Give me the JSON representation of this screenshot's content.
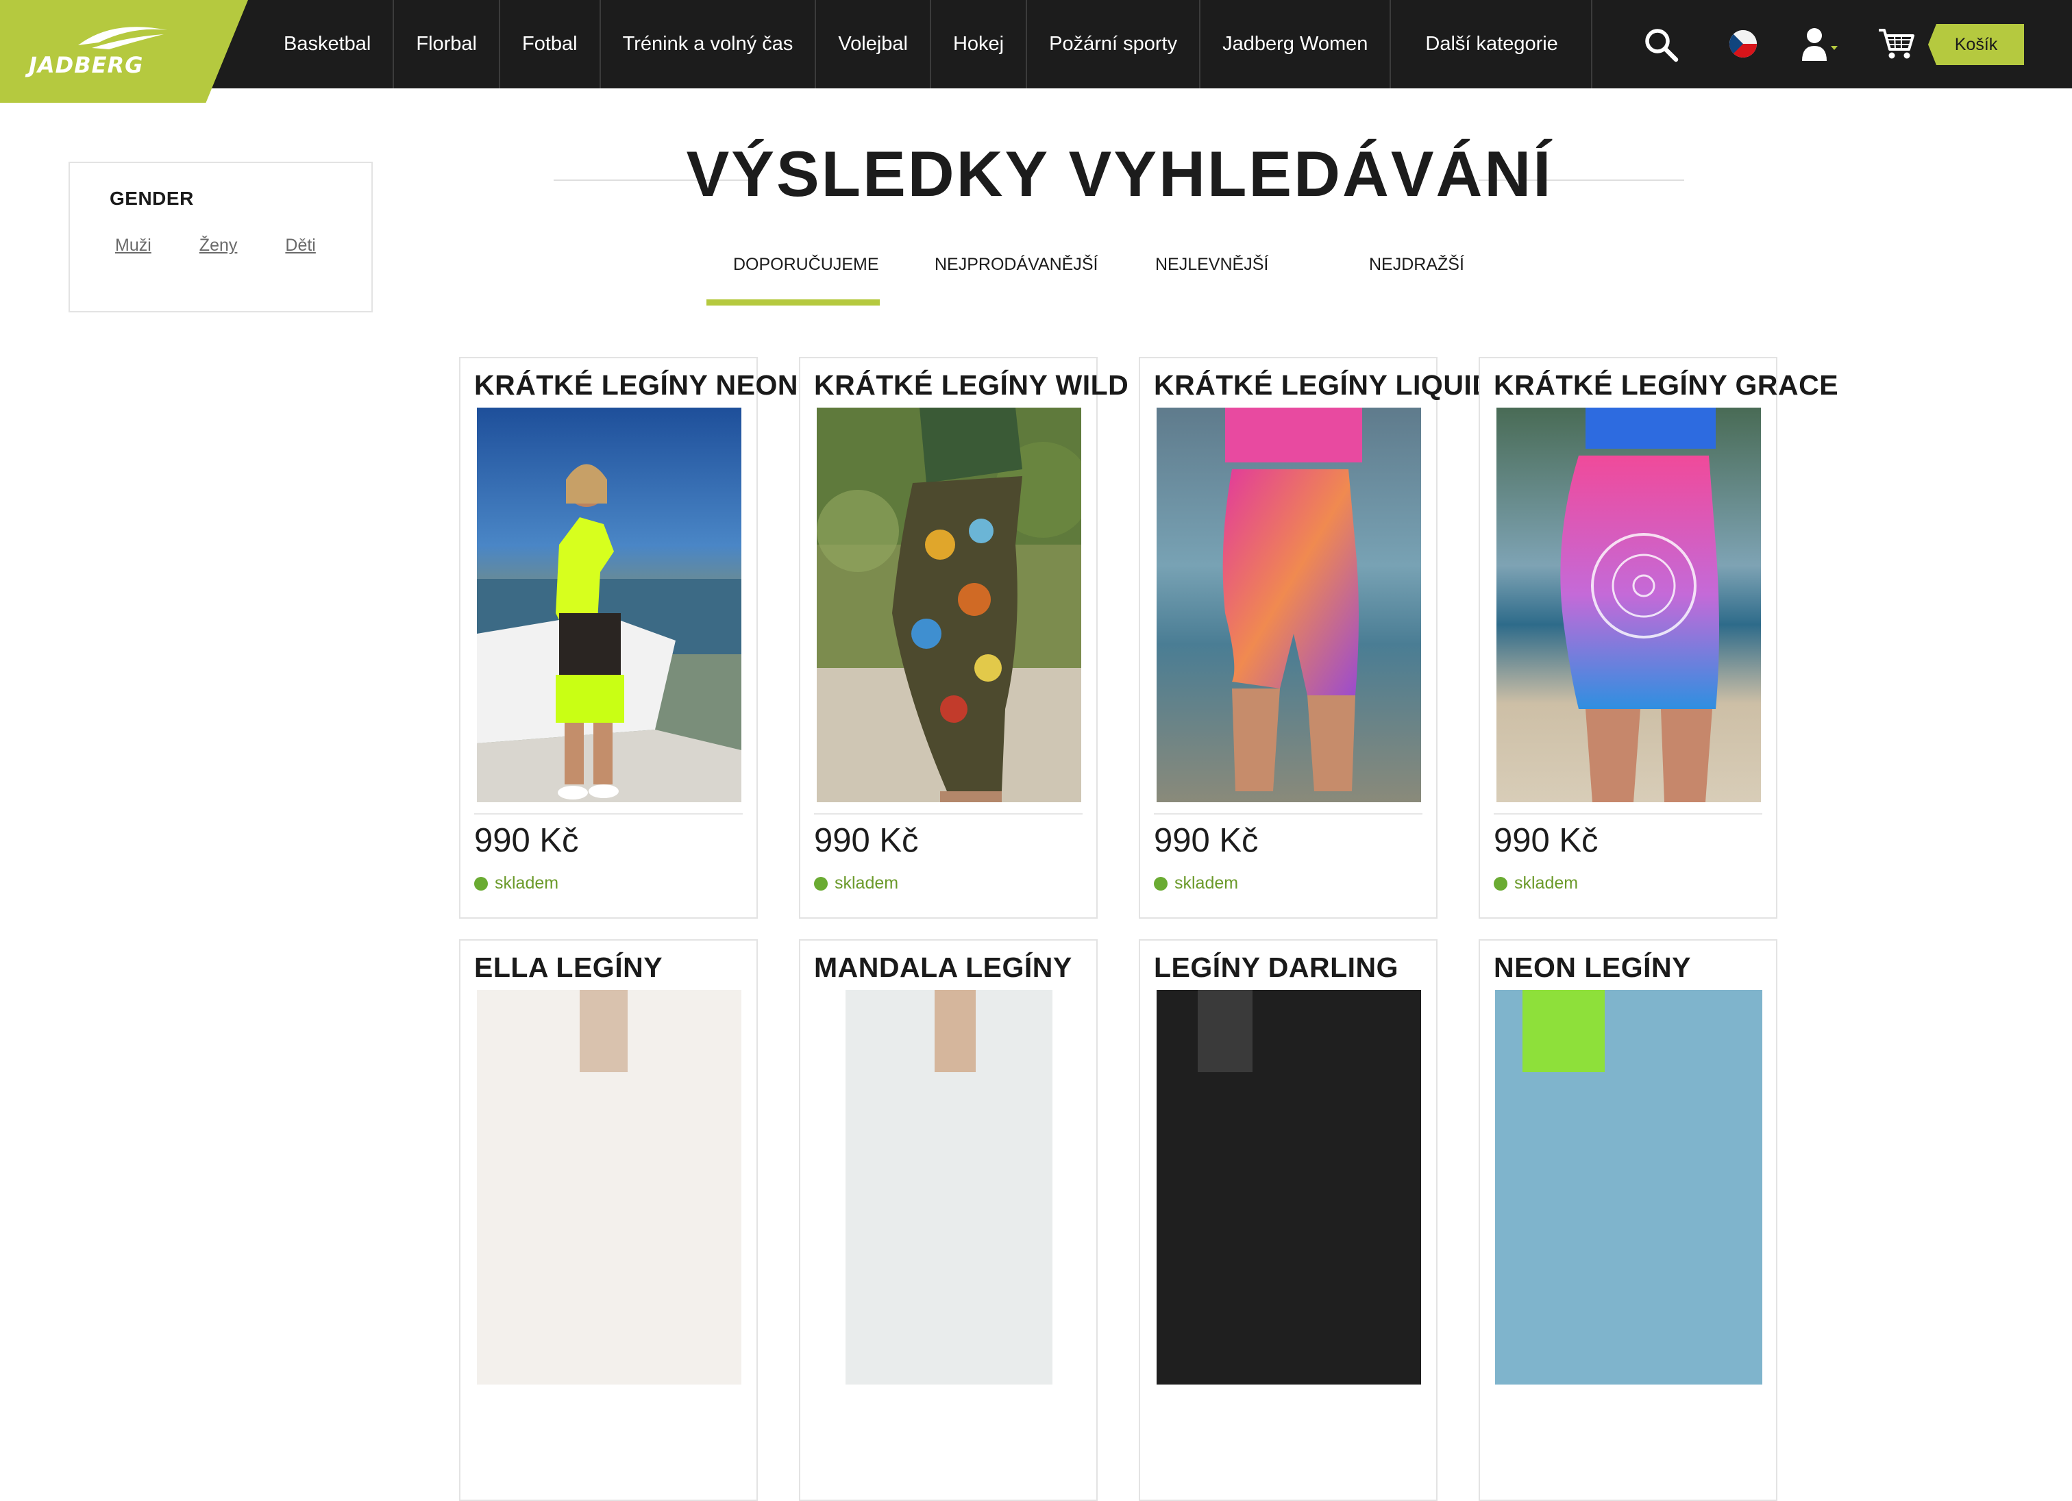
{
  "brand": {
    "logo_text": "JADBERG",
    "accent_color": "#b5c93f"
  },
  "nav": {
    "items": [
      "Basketbal",
      "Florbal",
      "Fotbal",
      "Trénink a volný čas",
      "Volejbal",
      "Hokej",
      "Požární sporty",
      "Jadberg Women",
      "Další kategorie"
    ]
  },
  "header": {
    "search_icon": "search-icon",
    "language_icon": "czech-flag-icon",
    "user_icon": "user-icon",
    "cart_icon": "cart-icon",
    "cart_label": "Košík"
  },
  "filter": {
    "title": "GENDER",
    "options": [
      "Muži",
      "Ženy",
      "Děti"
    ]
  },
  "page": {
    "title": "VÝSLEDKY VYHLEDÁVÁNÍ"
  },
  "sort": {
    "options": [
      "DOPORUČUJEME",
      "NEJPRODÁVANĚJŠÍ",
      "NEJLEVNĚJŠÍ",
      "NEJDRAŽŠÍ"
    ],
    "active": "DOPORUČUJEME"
  },
  "products": [
    {
      "name": "KRÁTKÉ LEGÍNY NEON",
      "price": "990 Kč",
      "stock": "skladem"
    },
    {
      "name": "KRÁTKÉ LEGÍNY WILD",
      "price": "990 Kč",
      "stock": "skladem"
    },
    {
      "name": "KRÁTKÉ LEGÍNY LIQUID",
      "price": "990 Kč",
      "stock": "skladem"
    },
    {
      "name": "KRÁTKÉ LEGÍNY GRACE",
      "price": "990 Kč",
      "stock": "skladem"
    },
    {
      "name": "ELLA LEGÍNY"
    },
    {
      "name": "MANDALA LEGÍNY"
    },
    {
      "name": "LEGÍNY DARLING"
    },
    {
      "name": "NEON LEGÍNY"
    }
  ]
}
